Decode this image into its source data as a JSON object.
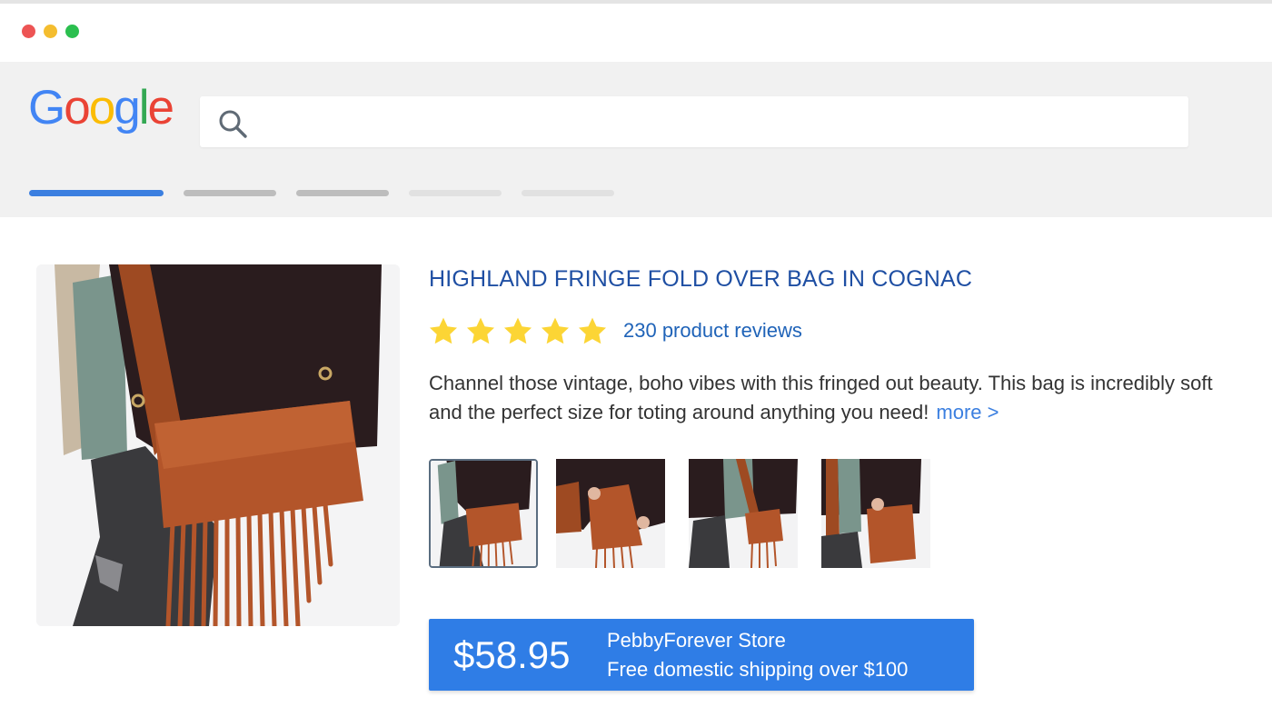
{
  "window": {
    "controls": [
      "close",
      "minimize",
      "maximize"
    ]
  },
  "search": {
    "logo_letters": [
      "G",
      "o",
      "o",
      "g",
      "l",
      "e"
    ],
    "value": "",
    "placeholder": "",
    "icon": "search-icon"
  },
  "tabs": [
    {
      "state": "active",
      "color": "#3b7fe0"
    },
    {
      "state": "inactive",
      "color": "#bdbdbd"
    },
    {
      "state": "inactive",
      "color": "#bdbdbd"
    },
    {
      "state": "inactive",
      "color": "#e1e1e1"
    },
    {
      "state": "inactive",
      "color": "#e1e1e1"
    }
  ],
  "product": {
    "title": "HIGHLAND FRINGE FOLD OVER BAG IN COGNAC",
    "rating": 5,
    "rating_max": 5,
    "reviews_label": "230 product reviews",
    "description": "Channel those vintage, boho vibes with this fringed out beauty. This bag is incredibly soft and the perfect size for toting around anything you need!",
    "more_label": "more >",
    "thumbnails_count": 4,
    "selected_thumbnail": 1
  },
  "offer": {
    "price": "$58.95",
    "store": "PebbyForever Store",
    "shipping": "Free domestic shipping over $100"
  },
  "colors": {
    "accent": "#2f7de6",
    "title": "#1f4fa3",
    "link": "#1f63b8",
    "star": "#fcd535",
    "bag": "#b3552a"
  }
}
